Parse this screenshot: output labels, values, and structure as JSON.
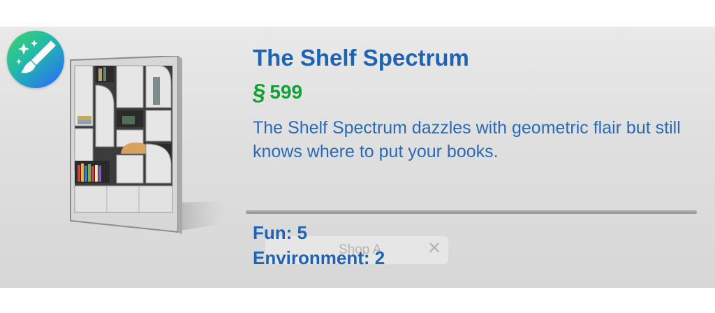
{
  "item": {
    "title": "The Shelf Spectrum",
    "currency_symbol": "§",
    "price": "599",
    "description": "The Shelf Spectrum dazzles with geometric flair but still knows where to put your books.",
    "stats": {
      "fun": "Fun: 5",
      "environment": "Environment: 2"
    }
  },
  "ghost_tab": {
    "label": "Shop A",
    "close": "✕"
  },
  "colors": {
    "title": "#1e63b4",
    "price": "#12a137",
    "description": "#2a6ab5",
    "panel": "#e0e0e0"
  },
  "icons": {
    "badge": "paintbrush-sparkle-icon",
    "item_image": "bookshelf-thumbnail"
  }
}
